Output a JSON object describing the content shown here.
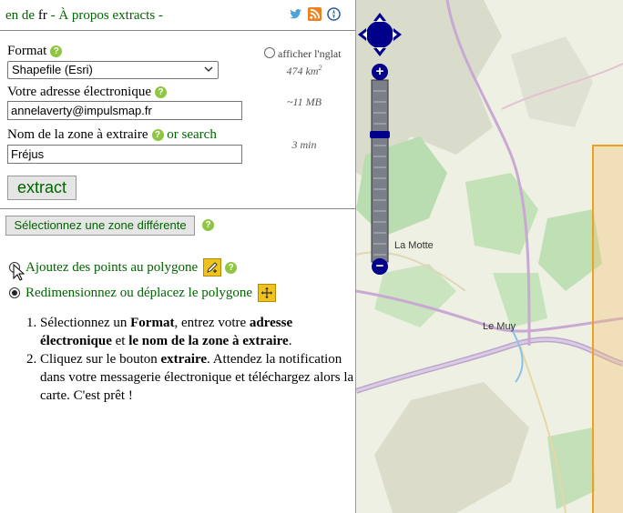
{
  "header": {
    "lang_en": "en",
    "lang_de": "de",
    "lang_fr": "fr",
    "sep": "-",
    "about": "À propos",
    "extracts": "extracts",
    "trail": "-"
  },
  "form": {
    "format_label": "Format",
    "format_value": "Shapefile (Esri)",
    "email_label": "Votre adresse électronique",
    "email_value": "annelaverty@impulsmap.fr",
    "zone_label": "Nom de la zone à extraire",
    "or_search": "or search",
    "zone_value": "Fréjus",
    "extract_button": "extract"
  },
  "info": {
    "english_toggle": "afficher l'nglat",
    "area": "474 km",
    "area_sup": "2",
    "size": "~11 MB",
    "time": "3 min"
  },
  "zone_button": "Sélectionnez une zone différente",
  "modes": {
    "add_points": "Ajoutez des points au polygone",
    "resize": "Redimensionnez ou déplacez le polygone"
  },
  "instructions": {
    "s1_a": "Sélectionnez un ",
    "s1_b": "Format",
    "s1_c": ", entrez votre ",
    "s1_d": "adresse électronique",
    "s1_e": " et ",
    "s1_f": "le nom de la zone à extraire",
    "s1_g": ".",
    "s2_a": "Cliquez sur le bouton ",
    "s2_b": "extraire",
    "s2_c": ". Attendez la notification dans votre messagerie électronique et téléchargez alors la carte. C'est prêt !"
  },
  "map": {
    "labels": {
      "la_motte": "La Motte",
      "le_muy": "Le Muy"
    },
    "zoom_plus": "+",
    "zoom_minus": "−"
  },
  "colors": {
    "accent_green": "#006400",
    "help_green": "#8fc641",
    "tool_yellow": "#f0c21d",
    "map_nav_blue": "#00008b",
    "selection_orange": "#f0a020"
  }
}
